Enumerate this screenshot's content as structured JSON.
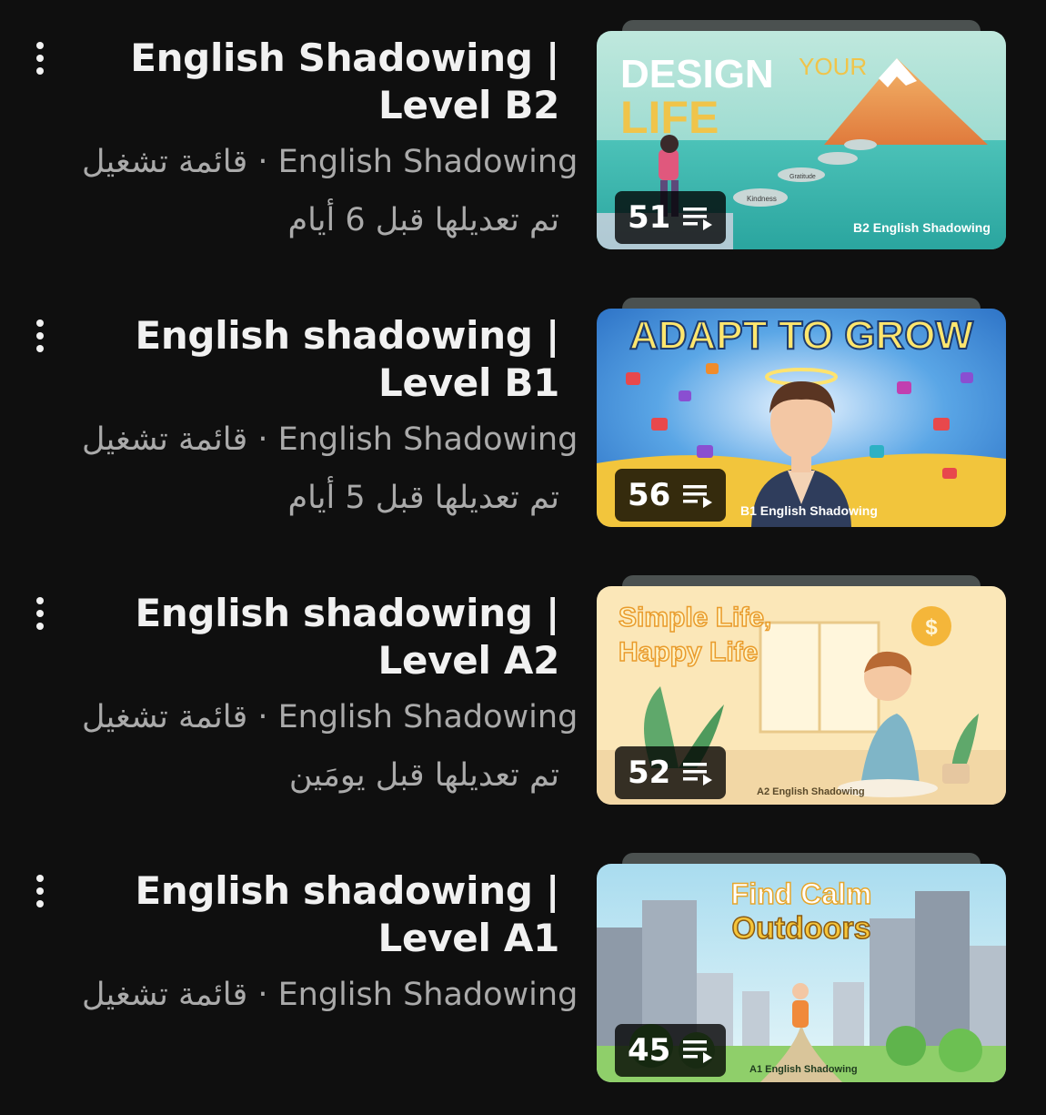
{
  "playlists": [
    {
      "title": "English Shadowing | Level B2",
      "meta": "قائمة تشغيل · English Shadowing",
      "updated": "تم تعديلها قبل 6 أيام",
      "count": "51",
      "thumb_caption": "B2 English Shadowing",
      "thumb_text": [
        "DESIGN",
        "YOUR",
        "LIFE"
      ],
      "stone_labels": [
        "Kindness",
        "Gratitude"
      ]
    },
    {
      "title": "English shadowing | Level B1",
      "meta": "قائمة تشغيل · English Shadowing",
      "updated": "تم تعديلها قبل 5 أيام",
      "count": "56",
      "thumb_caption": "B1 English Shadowing",
      "thumb_text": [
        "ADAPT TO GROW"
      ]
    },
    {
      "title": "English shadowing | Level A2",
      "meta": "قائمة تشغيل · English Shadowing",
      "updated": "تم تعديلها قبل يومَين",
      "count": "52",
      "thumb_caption": "A2 English Shadowing",
      "thumb_text": [
        "Simple Life,",
        "Happy  Life"
      ]
    },
    {
      "title": "English shadowing | Level A1",
      "meta": "قائمة تشغيل · English Shadowing",
      "updated": "",
      "count": "45",
      "thumb_caption": "A1 English Shadowing",
      "thumb_text": [
        "Find Calm",
        "Outdoors"
      ]
    }
  ],
  "icons": {
    "menu": "more-vert-icon",
    "playlist": "playlist-icon"
  },
  "colors": {
    "background": "#0f0f0f",
    "title": "#f1f1f1",
    "meta": "#aaaaaa"
  }
}
